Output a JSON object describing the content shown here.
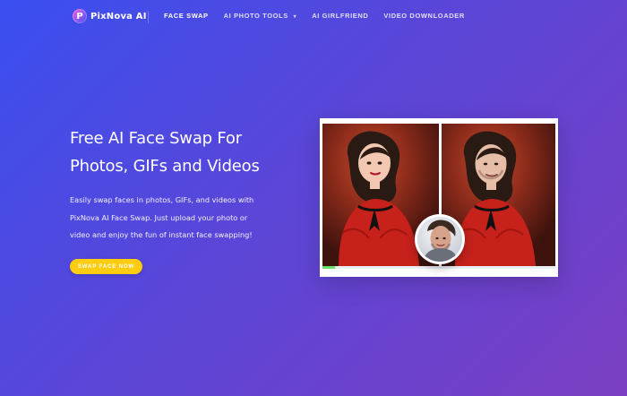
{
  "colors": {
    "bg_start": "#3a4ff0",
    "bg_end": "#7a3ec2",
    "cta": "#ffcc0f",
    "text": "#ffffff"
  },
  "brand": {
    "logo_letter": "P",
    "name": "PixNova AI"
  },
  "nav": {
    "items": [
      {
        "label": "FACE SWAP",
        "active": true,
        "has_dropdown": false
      },
      {
        "label": "AI PHOTO TOOLS",
        "active": false,
        "has_dropdown": true
      },
      {
        "label": "AI GIRLFRIEND",
        "active": false,
        "has_dropdown": false
      },
      {
        "label": "VIDEO DOWNLOADER",
        "active": false,
        "has_dropdown": false
      }
    ],
    "dropdown_icon": "chevron-down-icon"
  },
  "hero": {
    "title_lines": [
      "Free AI Face Swap For",
      "Photos, GIFs and Videos"
    ],
    "description_lines": [
      "Easily swap faces in photos, GIFs, and videos with",
      "PixNova AI Face Swap. Just upload your photo or",
      "video and enjoy the fun of instant face swapping!"
    ],
    "cta_label": "SWAP FACE NOW"
  }
}
